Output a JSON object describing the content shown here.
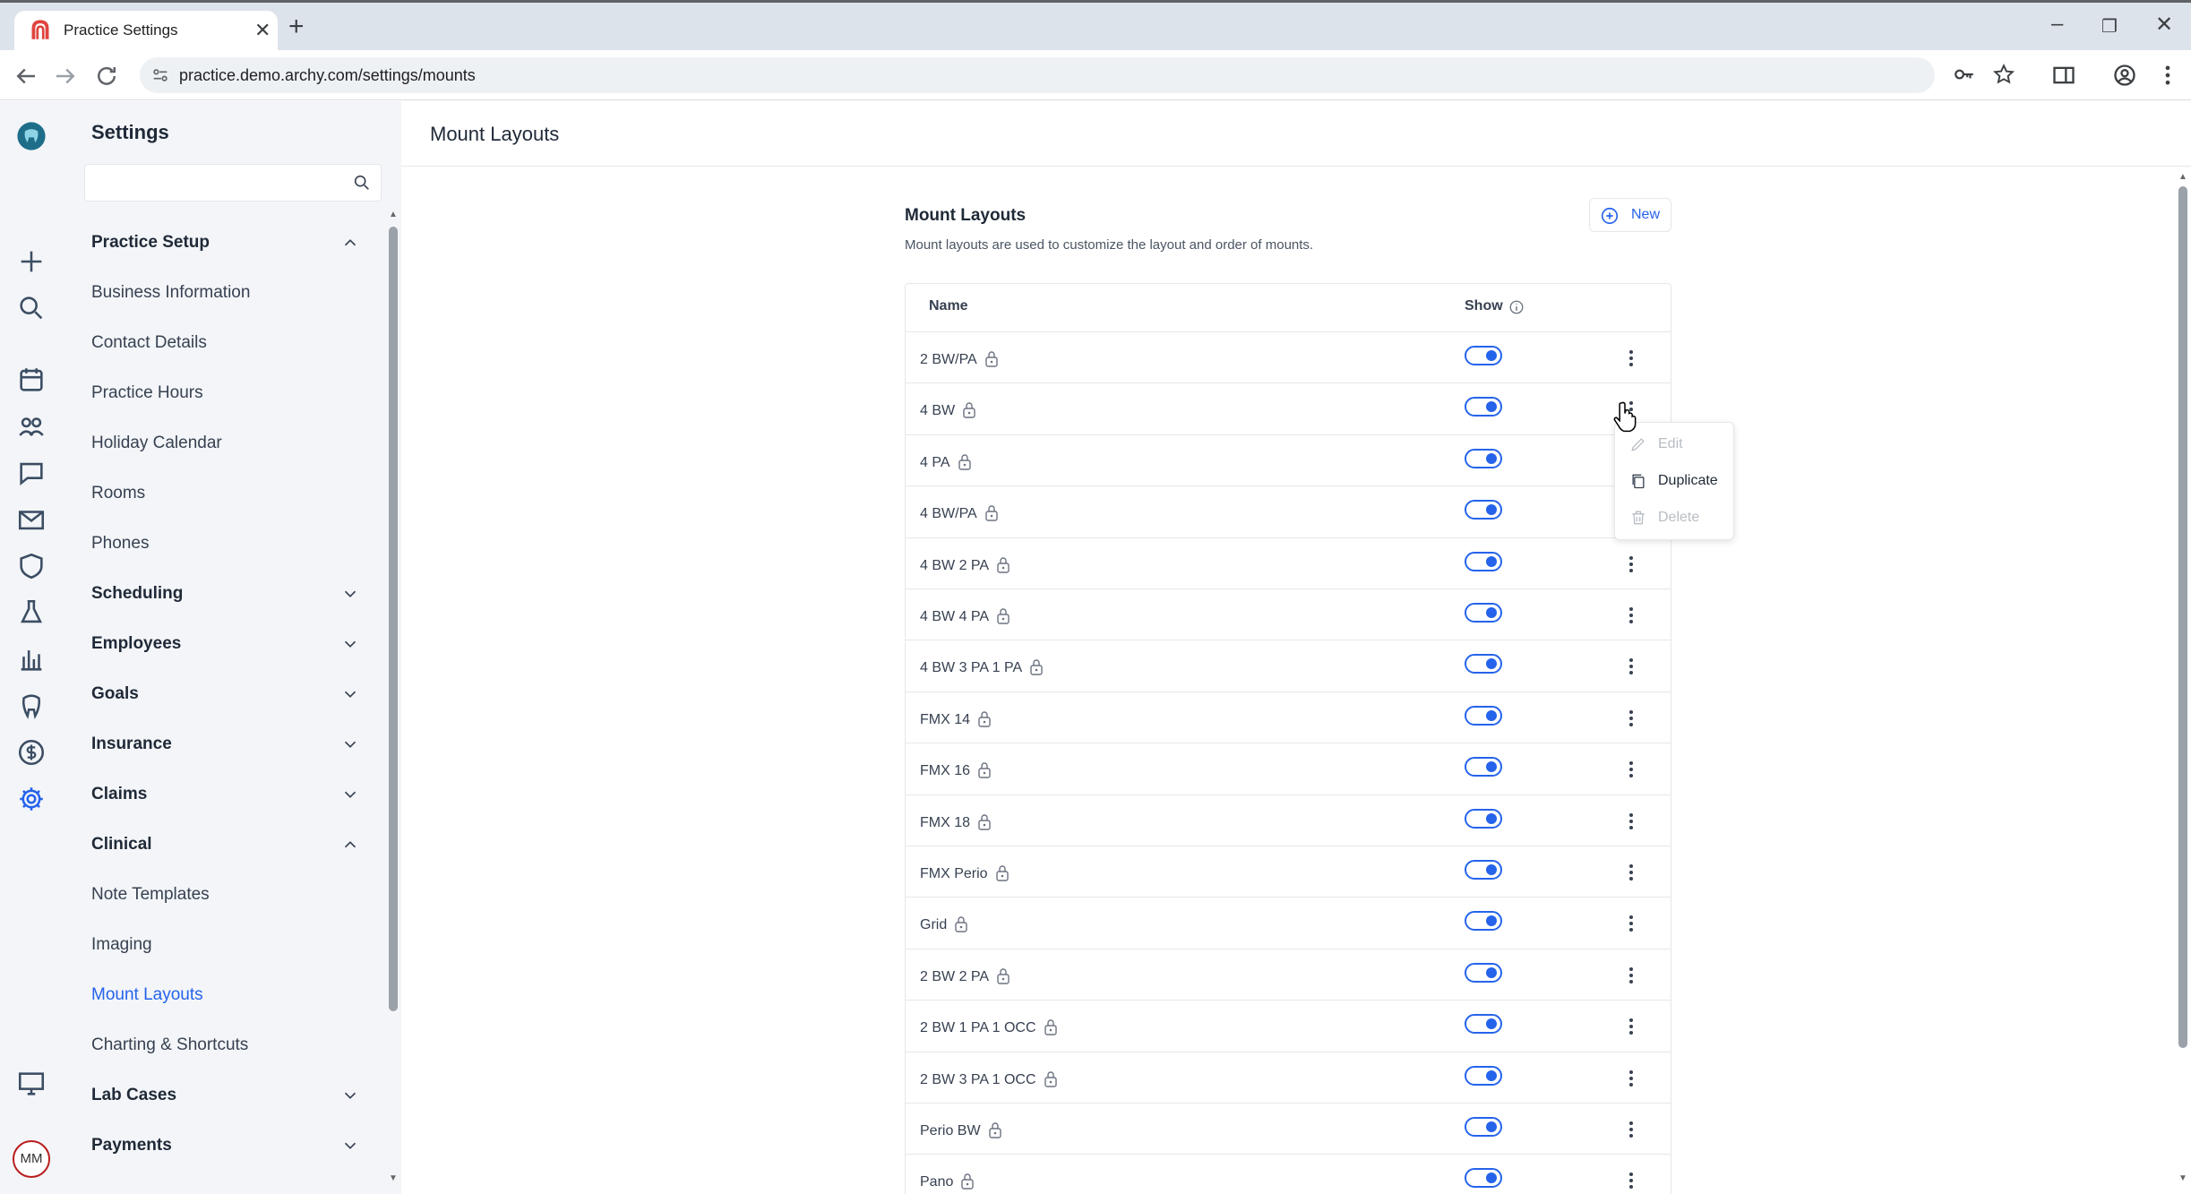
{
  "browser": {
    "tab_title": "Practice Settings",
    "url": "practice.demo.archy.com/settings/mounts"
  },
  "sidebar": {
    "title": "Settings",
    "search_placeholder": "",
    "groups": {
      "practice_setup": "Practice Setup",
      "scheduling": "Scheduling",
      "employees": "Employees",
      "goals": "Goals",
      "insurance": "Insurance",
      "claims": "Claims",
      "clinical": "Clinical",
      "lab_cases": "Lab Cases",
      "payments": "Payments"
    },
    "practice_setup_items": [
      "Business Information",
      "Contact Details",
      "Practice Hours",
      "Holiday Calendar",
      "Rooms",
      "Phones"
    ],
    "clinical_items": [
      "Note Templates",
      "Imaging",
      "Mount Layouts",
      "Charting & Shortcuts"
    ],
    "active_item": "Mount Layouts"
  },
  "user": {
    "initials": "MM"
  },
  "page": {
    "title": "Mount Layouts",
    "section_title": "Mount Layouts",
    "section_description": "Mount layouts are used to customize the layout and order of mounts.",
    "new_button": "New"
  },
  "table": {
    "headers": {
      "name": "Name",
      "show": "Show"
    },
    "rows": [
      {
        "name": "2 BW/PA",
        "show": true
      },
      {
        "name": "4 BW",
        "show": true
      },
      {
        "name": "4 PA",
        "show": true
      },
      {
        "name": "4 BW/PA",
        "show": true
      },
      {
        "name": "4 BW 2 PA",
        "show": true
      },
      {
        "name": "4 BW 4 PA",
        "show": true
      },
      {
        "name": "4 BW 3 PA 1 PA",
        "show": true
      },
      {
        "name": "FMX 14",
        "show": true
      },
      {
        "name": "FMX 16",
        "show": true
      },
      {
        "name": "FMX 18",
        "show": true
      },
      {
        "name": "FMX Perio",
        "show": true
      },
      {
        "name": "Grid",
        "show": true
      },
      {
        "name": "2 BW 2 PA",
        "show": true
      },
      {
        "name": "2 BW 1 PA 1 OCC",
        "show": true
      },
      {
        "name": "2 BW 3 PA 1 OCC",
        "show": true
      },
      {
        "name": "Perio BW",
        "show": true
      },
      {
        "name": "Pano",
        "show": true
      }
    ]
  },
  "context_menu": {
    "items": [
      {
        "label": "Edit",
        "enabled": false
      },
      {
        "label": "Duplicate",
        "enabled": true
      },
      {
        "label": "Delete",
        "enabled": false
      }
    ]
  },
  "colors": {
    "accent": "#2563eb",
    "brand": "#e0443e"
  }
}
